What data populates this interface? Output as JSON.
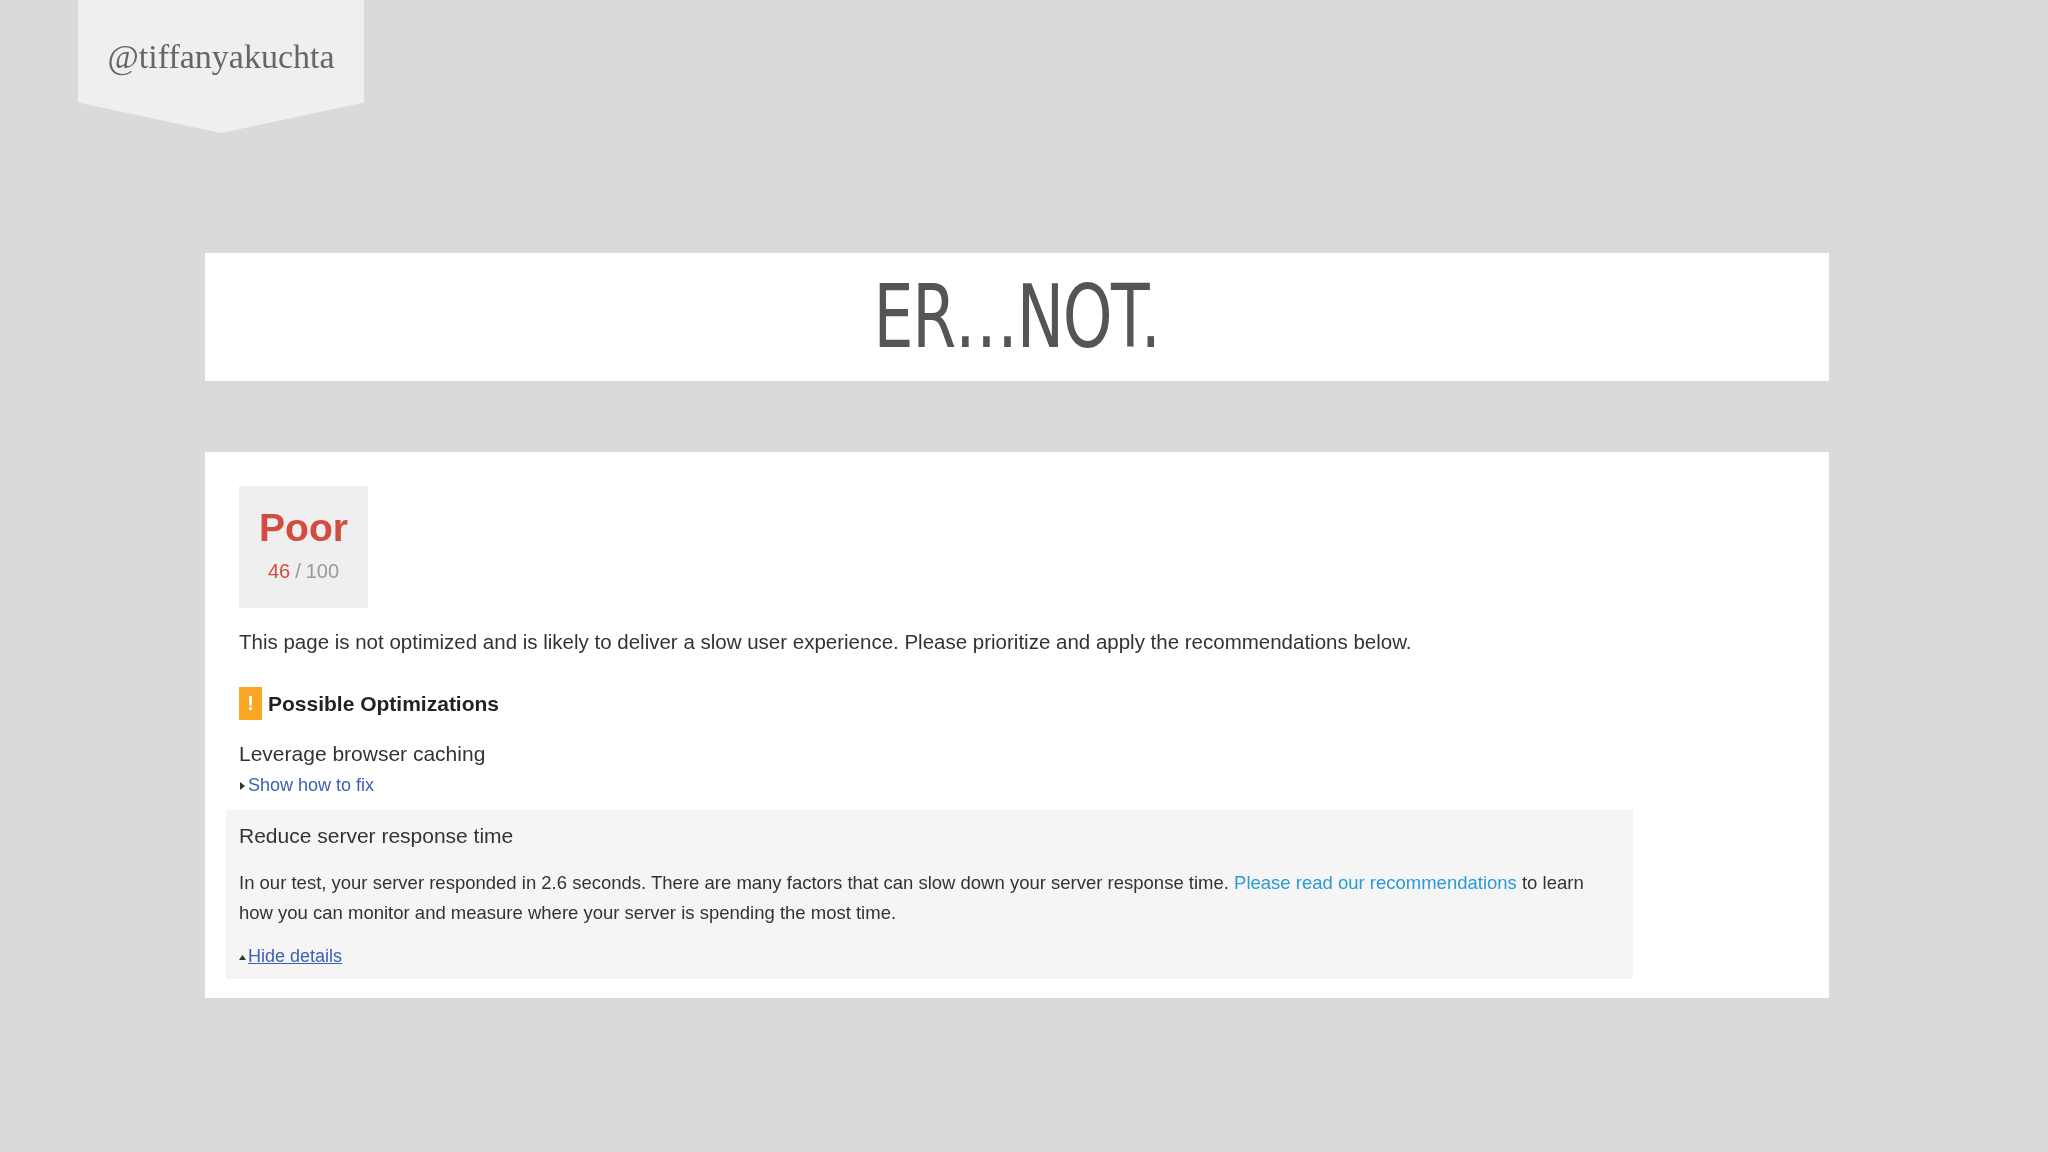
{
  "handle": "@tiffanyakuchta",
  "title": "ER…NOT.",
  "result": {
    "rating": "Poor",
    "score": "46",
    "separator": "/",
    "max": "100"
  },
  "summary": "This page is not optimized and is likely to deliver a slow user experience. Please prioritize and apply the recommendations below.",
  "section": {
    "title": "Possible Optimizations",
    "icon": "!",
    "items": [
      {
        "title": "Leverage browser caching",
        "expanded": false,
        "toggle": "Show how to fix"
      },
      {
        "title": "Reduce server response time",
        "expanded": true,
        "details": {
          "before": "In our test, your server responded in 2.6 seconds. There are many factors that can slow down your server response time.",
          "link": "Please read our recommendations",
          "after": "to learn how you can monitor and measure where your server is spending the most time."
        },
        "toggle": "Hide details"
      }
    ]
  }
}
